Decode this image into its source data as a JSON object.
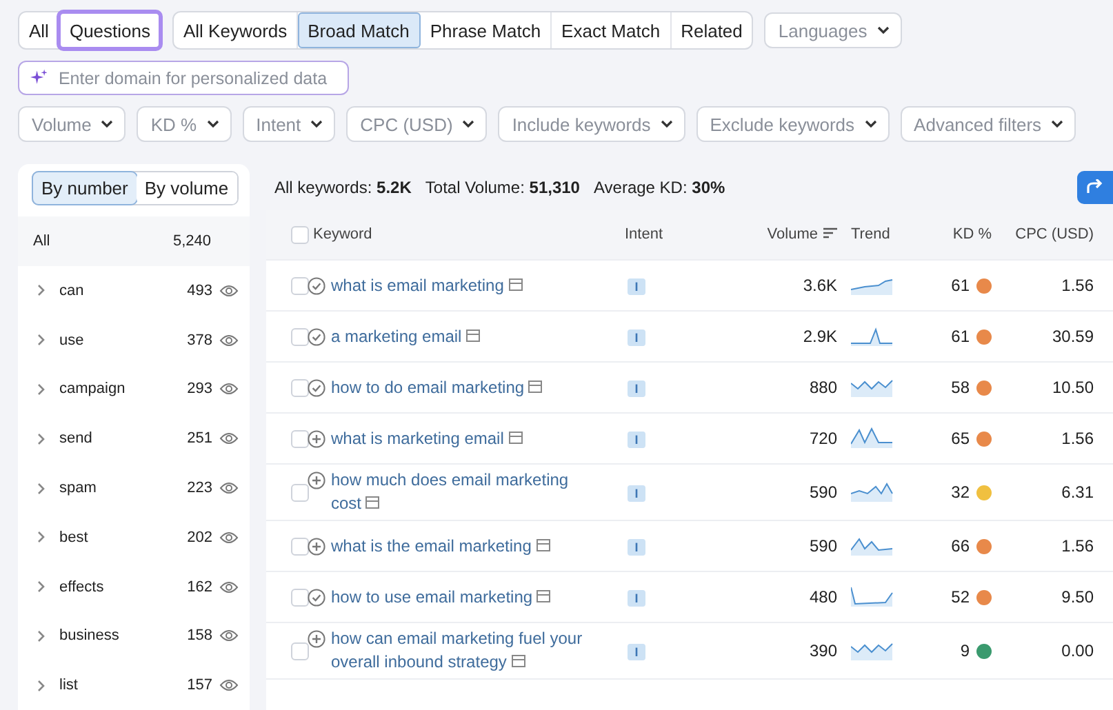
{
  "question_tabs": [
    {
      "label": "All",
      "selected": false
    },
    {
      "label": "Questions",
      "selected": true
    }
  ],
  "match_tabs": [
    {
      "label": "All Keywords",
      "selected": false
    },
    {
      "label": "Broad Match",
      "selected": true
    },
    {
      "label": "Phrase Match",
      "selected": false
    },
    {
      "label": "Exact Match",
      "selected": false
    },
    {
      "label": "Related",
      "selected": false
    }
  ],
  "languages": "Languages",
  "domain_field": {
    "placeholder": "Enter domain for personalized data"
  },
  "filters": [
    "Volume",
    "KD %",
    "Intent",
    "CPC (USD)",
    "Include keywords",
    "Exclude keywords",
    "Advanced filters"
  ],
  "group_toggle": [
    {
      "label": "By number",
      "selected": true
    },
    {
      "label": "By volume",
      "selected": false
    }
  ],
  "groups_header": {
    "label": "All",
    "count": "5,240"
  },
  "groups": [
    {
      "label": "can",
      "count": "493"
    },
    {
      "label": "use",
      "count": "378"
    },
    {
      "label": "campaign",
      "count": "293"
    },
    {
      "label": "send",
      "count": "251"
    },
    {
      "label": "spam",
      "count": "223"
    },
    {
      "label": "best",
      "count": "202"
    },
    {
      "label": "effects",
      "count": "162"
    },
    {
      "label": "business",
      "count": "158"
    },
    {
      "label": "list",
      "count": "157"
    }
  ],
  "summary": [
    {
      "label": "All keywords:",
      "value": "5.2K"
    },
    {
      "label": "Total Volume:",
      "value": "51,310"
    },
    {
      "label": "Average KD:",
      "value": "30%"
    }
  ],
  "table": {
    "all_checked": false,
    "columns": [
      "Keyword",
      "Intent",
      "Volume",
      "Trend",
      "KD %",
      "CPC (USD)"
    ],
    "rows": [
      {
        "keyword": "what is email marketing",
        "checked": false,
        "added": true,
        "intent": "I",
        "volume": "3.6K",
        "kd": "61",
        "color": "#e8894a",
        "cpc": "1.56"
      },
      {
        "keyword": "a marketing email",
        "checked": false,
        "added": true,
        "intent": "I",
        "volume": "2.9K",
        "kd": "61",
        "color": "#e8894a",
        "cpc": "30.59"
      },
      {
        "keyword": "how to do email marketing",
        "checked": false,
        "added": true,
        "intent": "I",
        "volume": "880",
        "kd": "58",
        "color": "#e8894a",
        "cpc": "10.50"
      },
      {
        "keyword": "what is marketing email",
        "checked": false,
        "added": false,
        "intent": "I",
        "volume": "720",
        "kd": "65",
        "color": "#e8894a",
        "cpc": "1.56"
      },
      {
        "keyword": "how much does email marketing cost",
        "checked": false,
        "added": false,
        "intent": "I",
        "volume": "590",
        "kd": "32",
        "color": "#f0c040",
        "cpc": "6.31"
      },
      {
        "keyword": "what is the email marketing",
        "checked": false,
        "added": false,
        "intent": "I",
        "volume": "590",
        "kd": "66",
        "color": "#e8894a",
        "cpc": "1.56"
      },
      {
        "keyword": "how to use email marketing",
        "checked": false,
        "added": true,
        "intent": "I",
        "volume": "480",
        "kd": "52",
        "color": "#e8894a",
        "cpc": "9.50"
      },
      {
        "keyword": "how can email marketing fuel your overall inbound strategy",
        "checked": false,
        "added": false,
        "intent": "I",
        "volume": "390",
        "kd": "9",
        "color": "#3a9a6e",
        "cpc": "0.00"
      }
    ]
  }
}
